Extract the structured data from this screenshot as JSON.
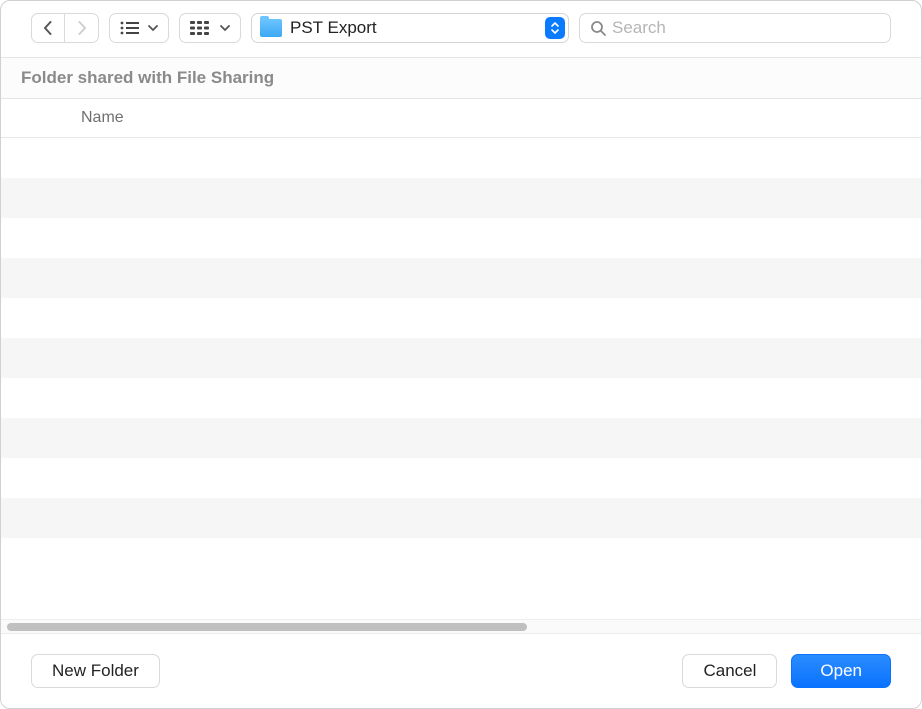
{
  "toolbar": {
    "location_label": "PST Export",
    "search_placeholder": "Search"
  },
  "banner": {
    "text": "Folder shared with File Sharing"
  },
  "columns": {
    "name": "Name"
  },
  "footer": {
    "new_folder_label": "New Folder",
    "cancel_label": "Cancel",
    "open_label": "Open"
  }
}
